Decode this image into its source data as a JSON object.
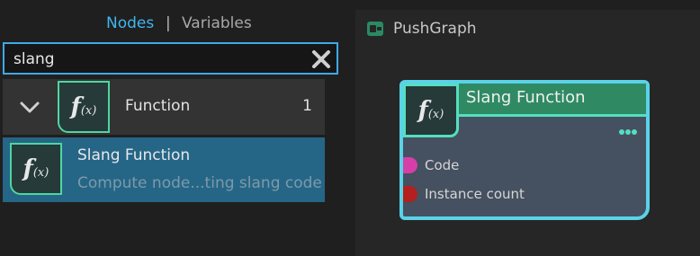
{
  "tabs": {
    "nodes": "Nodes",
    "separator": "|",
    "variables": "Variables"
  },
  "search": {
    "value": "slang"
  },
  "category": {
    "label": "Function",
    "count": "1"
  },
  "result": {
    "title": "Slang Function",
    "description": "Compute node...ting slang code"
  },
  "graph": {
    "title": "PushGraph",
    "node": {
      "title": "Slang Function",
      "ports": [
        {
          "label": "Code",
          "color": "#d63ea8"
        },
        {
          "label": "Instance count",
          "color": "#b3201f"
        }
      ]
    }
  },
  "colors": {
    "accent": "#3fb6f0",
    "selection": "#256687",
    "node_header": "#2f8a63",
    "node_border": "#5ad2e8"
  },
  "icons": {
    "function": "function-fx-icon",
    "clear": "clear-x-icon",
    "chevron": "chevron-down-icon",
    "graph": "graph-icon"
  }
}
